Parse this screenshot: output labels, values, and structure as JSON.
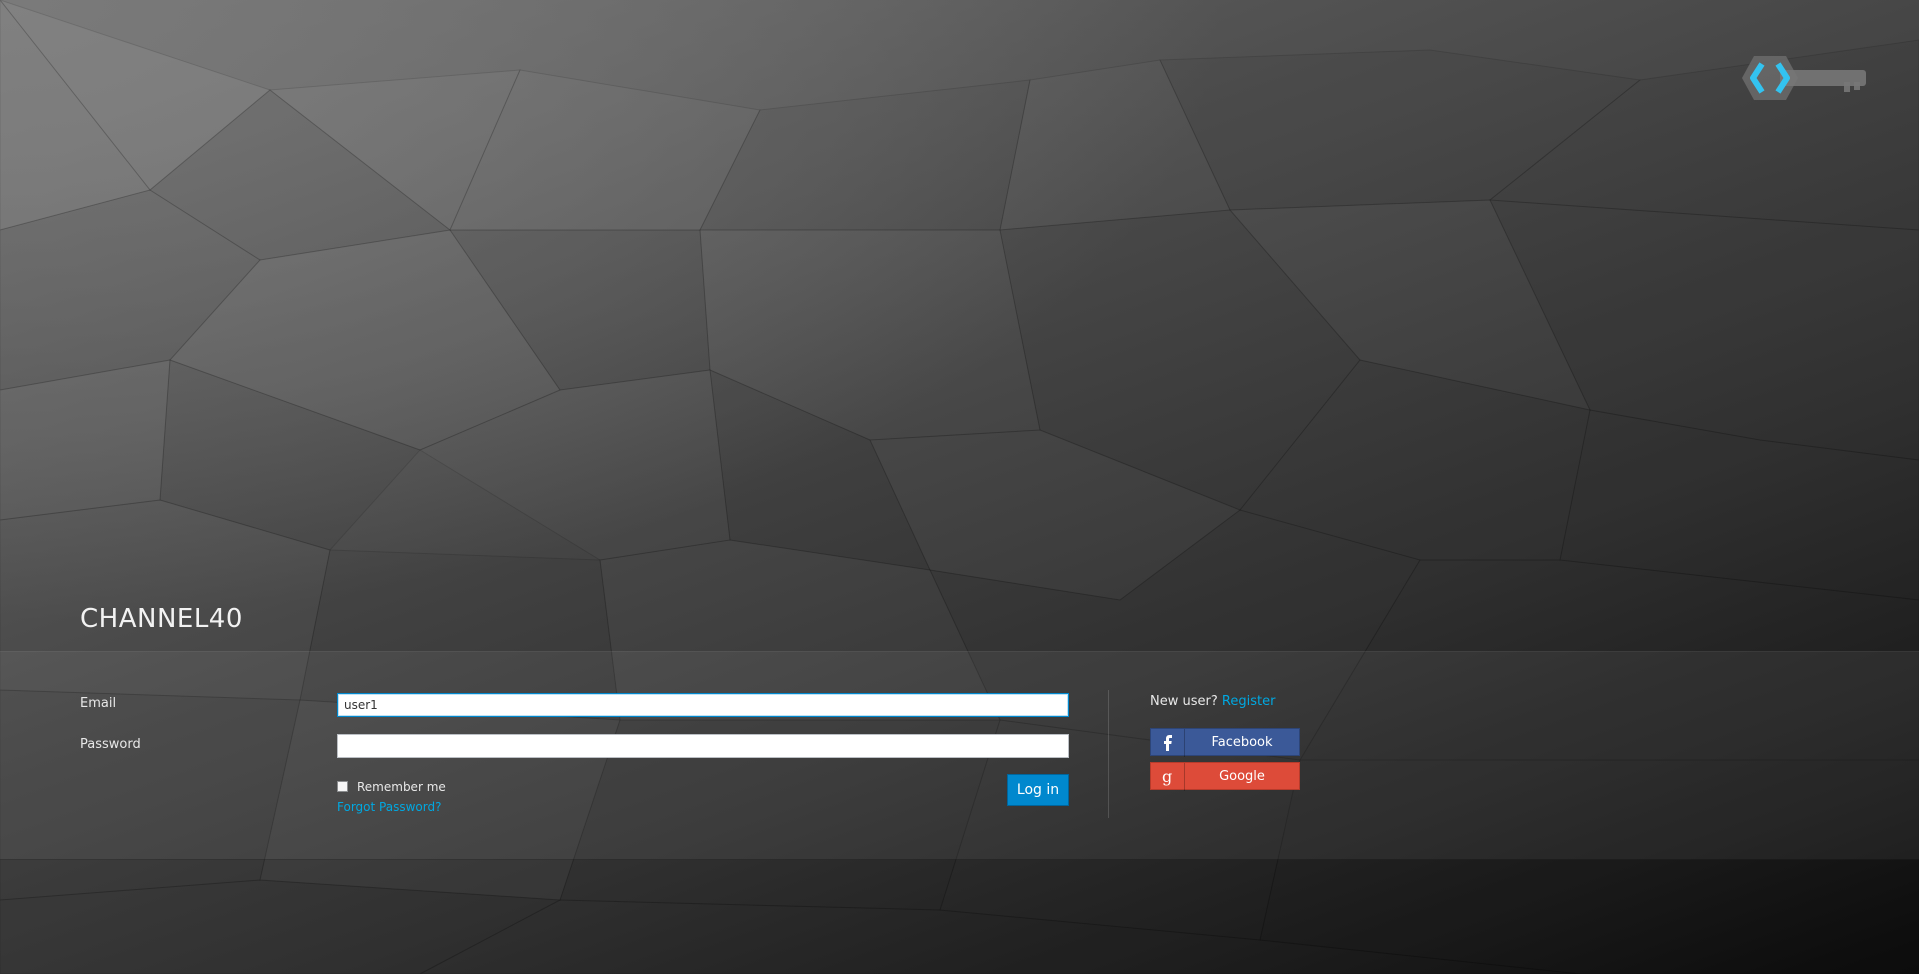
{
  "realm_title": "CHANNEL40",
  "logo": {
    "icon": "keycloak-logo-icon",
    "accent": "#33c3f0"
  },
  "form": {
    "email_label": "Email",
    "email_value": "user1",
    "password_label": "Password",
    "password_value": "",
    "remember_label": "Remember me",
    "remember_checked": false,
    "forgot_label": "Forgot Password?",
    "login_label": "Log in"
  },
  "registration": {
    "prompt": "New user?",
    "register_label": "Register"
  },
  "social": [
    {
      "label": "Facebook",
      "icon": "facebook-icon",
      "color": "#3b5998"
    },
    {
      "label": "Google",
      "icon": "google-icon",
      "color": "#dd4b39"
    }
  ],
  "colors": {
    "primary": "#0088ce",
    "link": "#00a8e1"
  }
}
